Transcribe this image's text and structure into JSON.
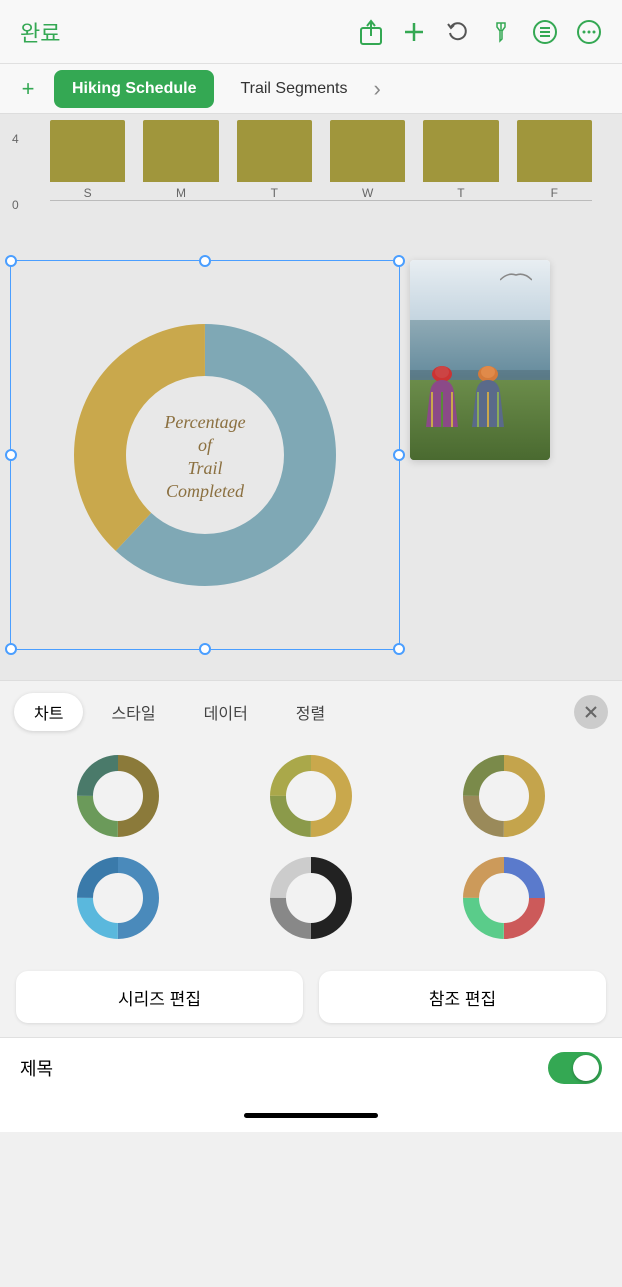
{
  "toolbar": {
    "done_label": "완료",
    "icons": {
      "share": "↑",
      "add": "+",
      "undo": "↺",
      "pin": "📌",
      "list": "≡",
      "more": "···"
    }
  },
  "tabs": {
    "add_label": "+",
    "items": [
      {
        "id": "hiking",
        "label": "Hiking Schedule",
        "active": true
      },
      {
        "id": "trail",
        "label": "Trail Segments",
        "active": false
      }
    ],
    "more_label": "›"
  },
  "bar_chart": {
    "y_labels": [
      "4",
      "0"
    ],
    "bars": [
      {
        "label": "S",
        "height_pct": 100
      },
      {
        "label": "M",
        "height_pct": 100
      },
      {
        "label": "T",
        "height_pct": 100
      },
      {
        "label": "W",
        "height_pct": 100
      },
      {
        "label": "T",
        "height_pct": 100
      },
      {
        "label": "F",
        "height_pct": 100
      }
    ]
  },
  "donut_chart": {
    "center_text": "Percentage\nof\nTrail\nCompleted",
    "segments": [
      {
        "color": "#7fa8b5",
        "percentage": 62
      },
      {
        "color": "#c9a84c",
        "percentage": 38
      }
    ]
  },
  "panel_tabs": [
    {
      "id": "chart",
      "label": "차트",
      "active": true
    },
    {
      "id": "style",
      "label": "스타일",
      "active": false
    },
    {
      "id": "data",
      "label": "데이터",
      "active": false
    },
    {
      "id": "arrange",
      "label": "정렬",
      "active": false
    }
  ],
  "chart_styles": [
    {
      "id": "style1",
      "colors": [
        "#8b7a3a",
        "#6b9a5a",
        "#4a7a6a",
        "#9a8a4a",
        "#5a6a8a"
      ]
    },
    {
      "id": "style2",
      "colors": [
        "#c9a84c",
        "#8b9a4a",
        "#6a8a5a",
        "#aaa84a",
        "#7a9a6a"
      ]
    },
    {
      "id": "style3",
      "colors": [
        "#9a8a5a",
        "#c4a44c",
        "#7a7a5a",
        "#aaa050",
        "#6a7a4a"
      ]
    },
    {
      "id": "style4",
      "colors": [
        "#4a8abb",
        "#5aa0cc",
        "#7abcde",
        "#3a7aaa",
        "#6aaabb"
      ]
    },
    {
      "id": "style5",
      "colors": [
        "#333",
        "#888",
        "#ccc",
        "#555",
        "#aaa"
      ]
    },
    {
      "id": "style6",
      "colors": [
        "#5a7acc",
        "#cc5a5a",
        "#5acc8a",
        "#cc9a5a",
        "#8a5acc"
      ]
    }
  ],
  "action_buttons": {
    "series_label": "시리즈 편집",
    "reference_label": "참조 편집"
  },
  "title_section": {
    "label": "제목",
    "toggle_on": true
  },
  "home_indicator": true
}
